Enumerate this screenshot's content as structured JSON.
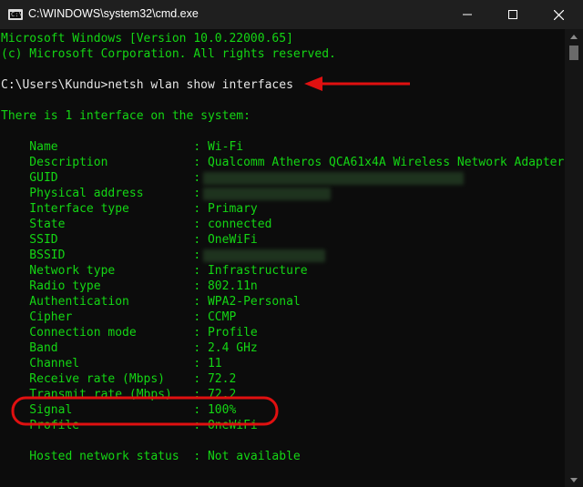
{
  "window": {
    "title": "C:\\WINDOWS\\system32\\cmd.exe",
    "icon_text": "C:\\"
  },
  "terminal": {
    "lines": [
      "Microsoft Windows [Version 10.0.22000.65]",
      "(c) Microsoft Corporation. All rights reserved.",
      "",
      "C:\\Users\\Kundu>netsh wlan show interfaces",
      "",
      "There is 1 interface on the system:",
      "",
      "    Name                   : Wi-Fi",
      "    Description            : Qualcomm Atheros QCA61x4A Wireless Network Adapter",
      "    GUID                   :",
      "    Physical address       :",
      "    Interface type         : Primary",
      "    State                  : connected",
      "    SSID                   : OneWiFi",
      "    BSSID                  :",
      "    Network type           : Infrastructure",
      "    Radio type             : 802.11n",
      "    Authentication         : WPA2-Personal",
      "    Cipher                 : CCMP",
      "    Connection mode        : Profile",
      "    Band                   : 2.4 GHz",
      "    Channel                : 11",
      "    Receive rate (Mbps)    : 72.2",
      "    Transmit rate (Mbps)   : 72.2",
      "    Signal                 : 100%",
      "    Profile                : OneWiFi",
      "",
      "    Hosted network status  : Not available"
    ]
  },
  "colors": {
    "terminal_text": "#14d614",
    "terminal_bg": "#0c0c0c",
    "annotation_red": "#e01010"
  }
}
